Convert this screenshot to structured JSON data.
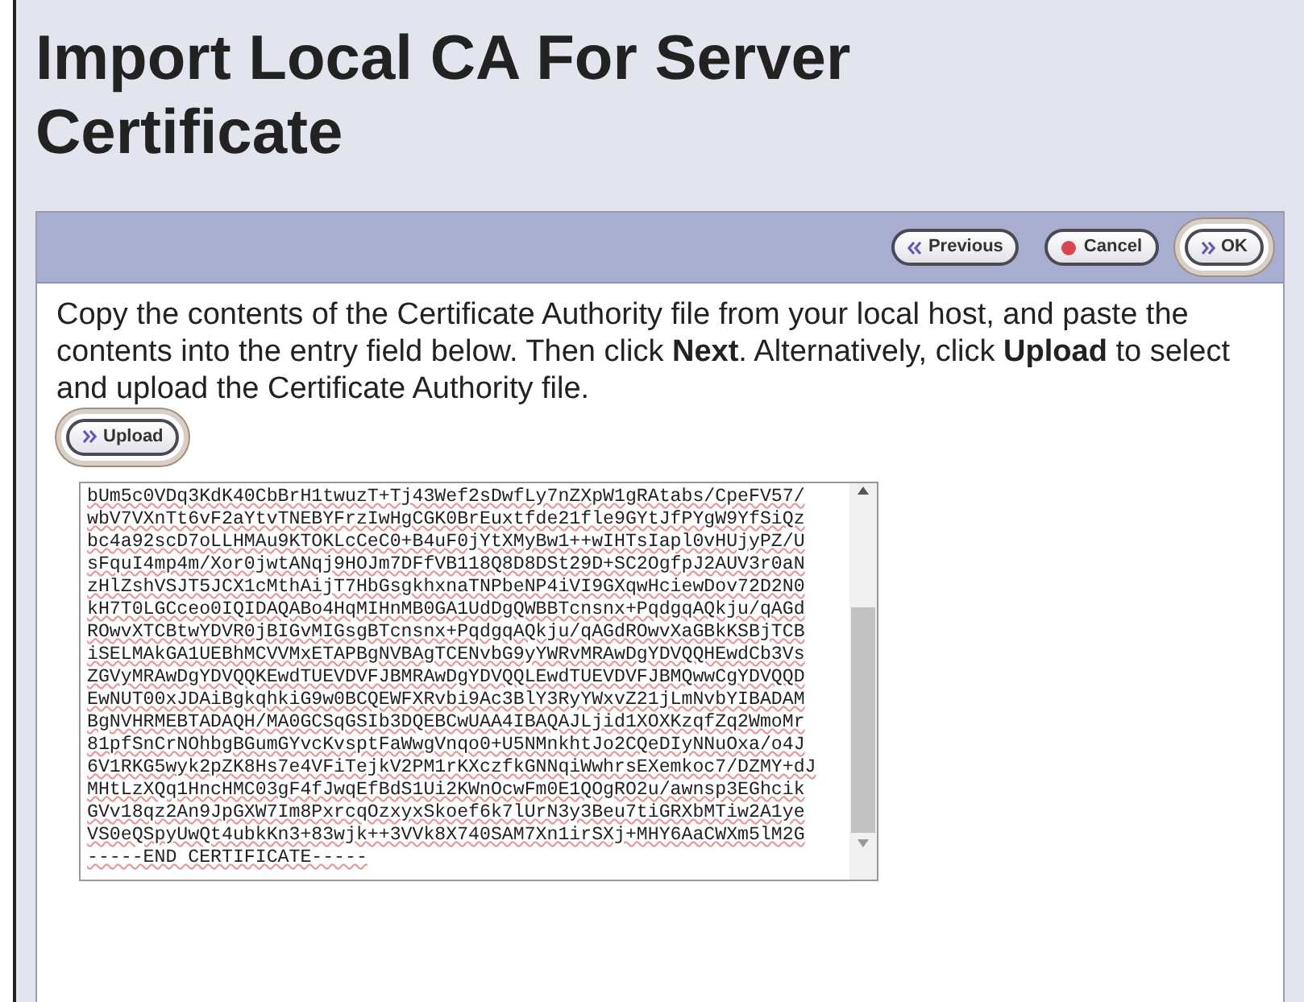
{
  "title": "Import Local CA For Server Certificate",
  "toolbar": {
    "buttons": [
      {
        "label": "Previous",
        "kind": "previous",
        "highlighted": false
      },
      {
        "label": "Cancel",
        "kind": "cancel",
        "highlighted": false
      },
      {
        "label": "OK",
        "kind": "next",
        "highlighted": true
      }
    ]
  },
  "instructions": "Copy the contents of the Certificate Authority file from your local host, and paste the contents into the entry field below. Then click **Next**. Alternatively, click **Upload** to select and upload the Certificate Authority file.",
  "upload_button": {
    "label": "Upload",
    "kind": "next",
    "highlighted": true
  },
  "certificate_field": {
    "value": [
      "bUm5c0VDq3KdK40CbBrH1twuzT+Tj43Wef2sDwfLy7nZXpW1gRAtabs/CpeFV57/",
      "wbV7VXnTt6vF2aYtvTNEBYFrzIwHgCGK0BrEuxtfde21fle9GYtJfPYgW9YfSiQz",
      "bc4a92scD7oLLHMAu9KTOKLcCeC0+B4uF0jYtXMyBw1++wIHTsIapl0vHUjyPZ/U",
      "sFquI4mp4m/Xor0jwtANqj9HOJm7DFfVB118Q8D8DSt29D+SC2OgfpJ2AUV3r0aN",
      "zHlZshVSJT5JCX1cMthAijT7HbGsgkhxnaTNPbeNP4iVI9GXqwHciewDov72D2N0",
      "kH7T0LGCceo0IQIDAQABo4HqMIHnMB0GA1UdDgQWBBTcnsnx+PqdgqAQkju/qAGd",
      "ROwvXTCBtwYDVR0jBIGvMIGsgBTcnsnx+PqdgqAQkju/qAGdROwvXaGBkKSBjTCB",
      "iSELMAkGA1UEBhMCVVMxETAPBgNVBAgTCENvbG9yYWRvMRAwDgYDVQQHEwdCb3Vs",
      "ZGVyMRAwDgYDVQQKEwdTUEVDVFJBMRAwDgYDVQQLEwdTUEVDVFJBMQwwCgYDVQQD",
      "EwNUT00xJDAiBgkqhkiG9w0BCQEWFXRvbi9Ac3BlY3RyYWxvZ21jLmNvbYIBADAM",
      "BgNVHRMEBTADAQH/MA0GCSqGSIb3DQEBCwUAA4IBAQAJLjid1XOXKzqfZq2WmoMr",
      "81pfSnCrNOhbgBGumGYvcKvsptFaWwgVnqo0+U5NMnkhtJo2CQeDIyNNuOxa/o4J",
      "6V1RKG5wyk2pZK8Hs7e4VFiTejkV2PM1rKXczfkGNNqiWwhrsEXemkoc7/DZMY+dJ",
      "MHtLzXQq1HncHMC03gF4fJwqEfBdS1Ui2KWnOcwFm0E1QOgRO2u/awnsp3EGhcik",
      "GVv18qz2An9JpGXW7Im8PxrcqOzxyxSkoef6k7lUrN3y3Beu7tiGRXbMTiw2A1ye",
      "VS0eQSpyUwQt4ubkKn3+83wjk++3VVk8X740SAM7Xn1irSXj+MHY6AaCWXm5lM2G",
      "-----END CERTIFICATE-----"
    ]
  }
}
